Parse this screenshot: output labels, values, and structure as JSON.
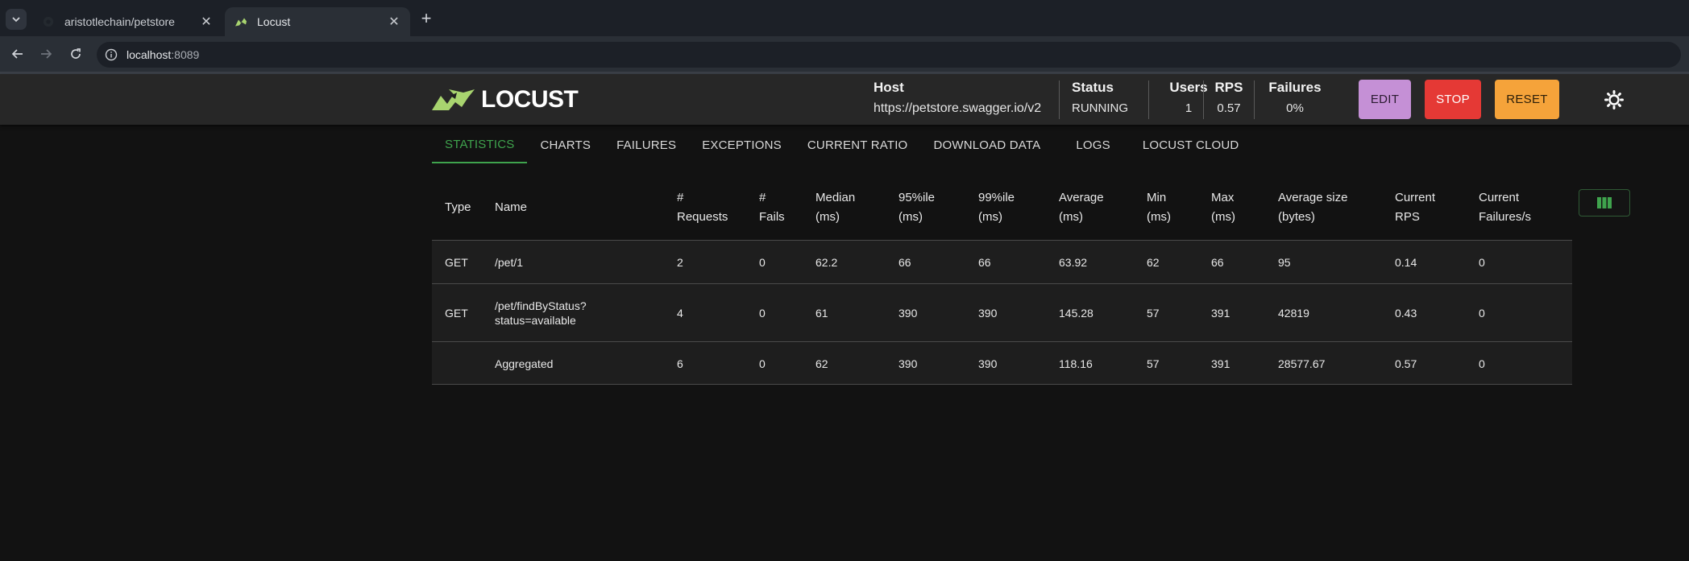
{
  "browser": {
    "tabs": [
      {
        "title": "aristotlechain/petstore",
        "active": false
      },
      {
        "title": "Locust",
        "active": true
      }
    ],
    "url_host": "localhost",
    "url_port": ":8089"
  },
  "header": {
    "logo_text": "LOCUST",
    "host_label": "Host",
    "host_value": "https://petstore.swagger.io/v2",
    "status_label": "Status",
    "status_value": "RUNNING",
    "users_label": "Users",
    "users_value": "1",
    "rps_label": "RPS",
    "rps_value": "0.57",
    "failures_label": "Failures",
    "failures_value": "0%",
    "edit_label": "EDIT",
    "stop_label": "STOP",
    "reset_label": "RESET"
  },
  "nav": {
    "tabs": [
      "STATISTICS",
      "CHARTS",
      "FAILURES",
      "EXCEPTIONS",
      "CURRENT RATIO",
      "DOWNLOAD DATA",
      "LOGS",
      "LOCUST CLOUD"
    ]
  },
  "table": {
    "headers": [
      [
        "Type"
      ],
      [
        "Name"
      ],
      [
        "#",
        "Requests"
      ],
      [
        "#",
        "Fails"
      ],
      [
        "Median",
        "(ms)"
      ],
      [
        "95%ile",
        "(ms)"
      ],
      [
        "99%ile",
        "(ms)"
      ],
      [
        "Average",
        "(ms)"
      ],
      [
        "Min",
        "(ms)"
      ],
      [
        "Max",
        "(ms)"
      ],
      [
        "Average size",
        "(bytes)"
      ],
      [
        "Current",
        "RPS"
      ],
      [
        "Current",
        "Failures/s"
      ]
    ],
    "rows": [
      [
        "GET",
        [
          "/pet/1"
        ],
        "2",
        "0",
        "62.2",
        "66",
        "66",
        "63.92",
        "62",
        "66",
        "95",
        "0.14",
        "0"
      ],
      [
        "GET",
        [
          "/pet/findByStatus?",
          "status=available"
        ],
        "4",
        "0",
        "61",
        "390",
        "390",
        "145.28",
        "57",
        "391",
        "42819",
        "0.43",
        "0"
      ],
      [
        "",
        [
          "Aggregated"
        ],
        "6",
        "0",
        "62",
        "390",
        "390",
        "118.16",
        "57",
        "391",
        "28577.67",
        "0.57",
        "0"
      ]
    ]
  },
  "icons": {
    "tab_menu": "chevron-down-icon",
    "back": "arrow-left-icon",
    "forward": "arrow-right-icon",
    "reload": "reload-icon",
    "site_info": "info-icon",
    "theme": "sun-icon",
    "columns": "columns-icon"
  },
  "colors": {
    "accent_green": "#3fa34d",
    "edit": "#c590d6",
    "stop": "#e53935",
    "reset": "#f5a33a"
  }
}
